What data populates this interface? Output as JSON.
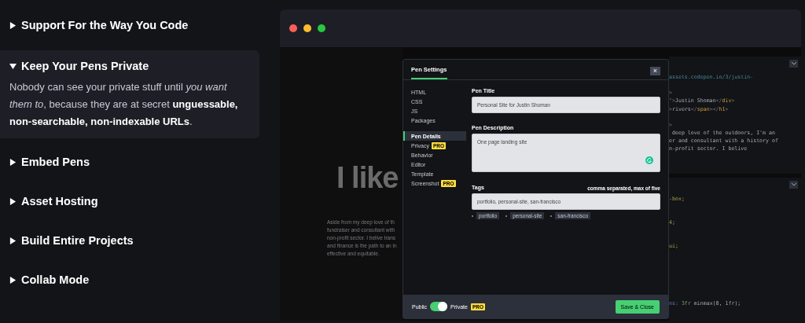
{
  "features": [
    {
      "title": "Support For the Way You Code",
      "expanded": false
    },
    {
      "title": "Keep Your Pens Private",
      "expanded": true,
      "body": "Nobody can see your private stuff until *you want them to*, because they are at secret **unguessable, non-searchable, non-indexable URLs**."
    },
    {
      "title": "Embed Pens",
      "expanded": false
    },
    {
      "title": "Asset Hosting",
      "expanded": false
    },
    {
      "title": "Build Entire Projects",
      "expanded": false
    },
    {
      "title": "Collab Mode",
      "expanded": false
    }
  ],
  "preview": {
    "heading": "I like",
    "paragraph": [
      "Aside from my deep love of th",
      "fundraiser and consultant with",
      "non-profit sector. I belive trans",
      "and finance is the path to an in",
      "effective and equitable."
    ]
  },
  "code_panes": [
    {
      "kind": "html",
      "lines": [
        {
          "segments": [
            {
              "text": "assets.codepen.io/3/justin-",
              "kind": "string"
            }
          ]
        },
        {
          "gap_before": true,
          "segments": [
            {
              "text": ">",
              "kind": "punct"
            }
          ]
        },
        {
          "segments": [
            {
              "text": "\">",
              "kind": "punct"
            },
            {
              "text": "Justin Shoman",
              "kind": "text"
            },
            {
              "text": "</",
              "kind": "punct"
            },
            {
              "text": "div",
              "kind": "tag"
            },
            {
              "text": ">",
              "kind": "punct"
            }
          ]
        },
        {
          "segments": [
            {
              "text": ">",
              "kind": "punct"
            },
            {
              "text": "rivers",
              "kind": "text"
            },
            {
              "text": "</",
              "kind": "punct"
            },
            {
              "text": "span",
              "kind": "tag"
            },
            {
              "text": "></",
              "kind": "punct"
            },
            {
              "text": "h1",
              "kind": "tag"
            },
            {
              "text": ">",
              "kind": "punct"
            }
          ]
        },
        {
          "gap_before": true,
          "segments": [
            {
              "text": ">",
              "kind": "punct"
            }
          ]
        },
        {
          "segments": [
            {
              "text": " deep love of the outdoors, I'm an",
              "kind": "text"
            }
          ]
        },
        {
          "segments": [
            {
              "text": "er and consultant with a history of",
              "kind": "text"
            }
          ]
        },
        {
          "segments": [
            {
              "text": "n-profit sector. I belive",
              "kind": "text"
            }
          ]
        }
      ]
    },
    {
      "kind": "css",
      "lines": [
        {
          "segments": [
            {
              "text": "-box;",
              "kind": "value"
            }
          ]
        },
        {
          "segments": [
            {
              "text": "4;",
              "kind": "value"
            }
          ]
        },
        {
          "segments": [
            {
              "text": "ui;",
              "kind": "value"
            }
          ]
        },
        {
          "gap_before": true,
          "segments": [
            {
              "text": "ns: ",
              "kind": "prop"
            },
            {
              "text": "3fr",
              "kind": "number"
            },
            {
              "text": " minmax(0, 1fr);",
              "kind": "text"
            }
          ]
        }
      ]
    }
  ],
  "modal": {
    "title": "Pen Settings",
    "close": "×",
    "nav": [
      {
        "label": "HTML",
        "selected": false
      },
      {
        "label": "CSS",
        "selected": false
      },
      {
        "label": "JS",
        "selected": false
      },
      {
        "label": "Packages",
        "selected": false,
        "gap_after": true
      },
      {
        "label": "Pen Details",
        "selected": true
      },
      {
        "label": "Privacy",
        "selected": false,
        "badge": "PRO"
      },
      {
        "label": "Behavior",
        "selected": false
      },
      {
        "label": "Editor",
        "selected": false
      },
      {
        "label": "Template",
        "selected": false
      },
      {
        "label": "Screenshot",
        "selected": false,
        "badge": "PRO"
      }
    ],
    "title_field": {
      "label": "Pen Title",
      "value": "Personal Site for Justin Shoman"
    },
    "description_field": {
      "label": "Pen Description",
      "value": "One page landing site"
    },
    "tags_field": {
      "label": "Tags",
      "hint": "comma separated, max of five",
      "value": "portfolio, personal-site, san-francisco",
      "chips": [
        "portfolio",
        "personal-site",
        "san-francisco"
      ]
    },
    "footer": {
      "public_label": "Public",
      "private": true,
      "private_label": "Private",
      "badge": "PRO",
      "save": "Save & Close"
    }
  }
}
